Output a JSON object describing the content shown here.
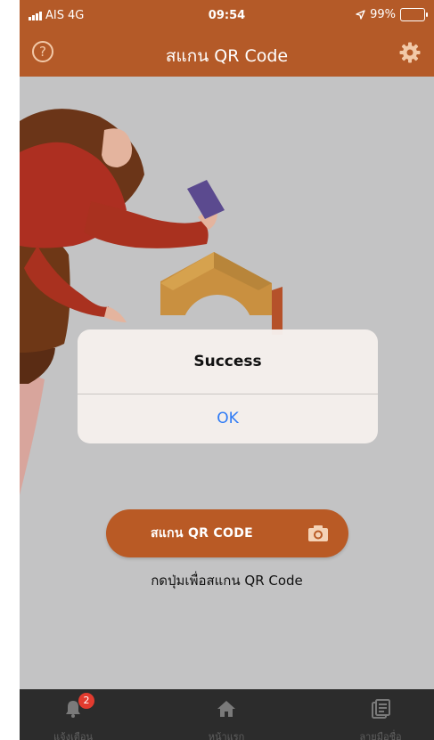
{
  "status_bar": {
    "carrier": "AIS",
    "network": "4G",
    "time": "09:54",
    "battery": "99%",
    "battery_level": 0.99
  },
  "header": {
    "title": "สแกน QR Code",
    "help_icon": "question-circle-icon",
    "settings_icon": "gear-icon"
  },
  "dialog": {
    "title": "Success",
    "ok_label": "OK"
  },
  "scan_button": {
    "label": "สแกน QR CODE",
    "icon": "camera-icon"
  },
  "hint": "กดปุ่มเพื่อสแกน QR Code",
  "tabs": [
    {
      "label": "แจ้งเตือน",
      "icon": "bell-icon",
      "badge": "2"
    },
    {
      "label": "หน้าแรก",
      "icon": "home-icon"
    },
    {
      "label": "ลายมือชื่อ",
      "icon": "document-list-icon"
    }
  ],
  "colors": {
    "brand": "#b45a28",
    "background": "#c3c3c4",
    "tabbar": "#2c2c2c",
    "link": "#2f7bf5",
    "badge": "#e23b2f"
  }
}
